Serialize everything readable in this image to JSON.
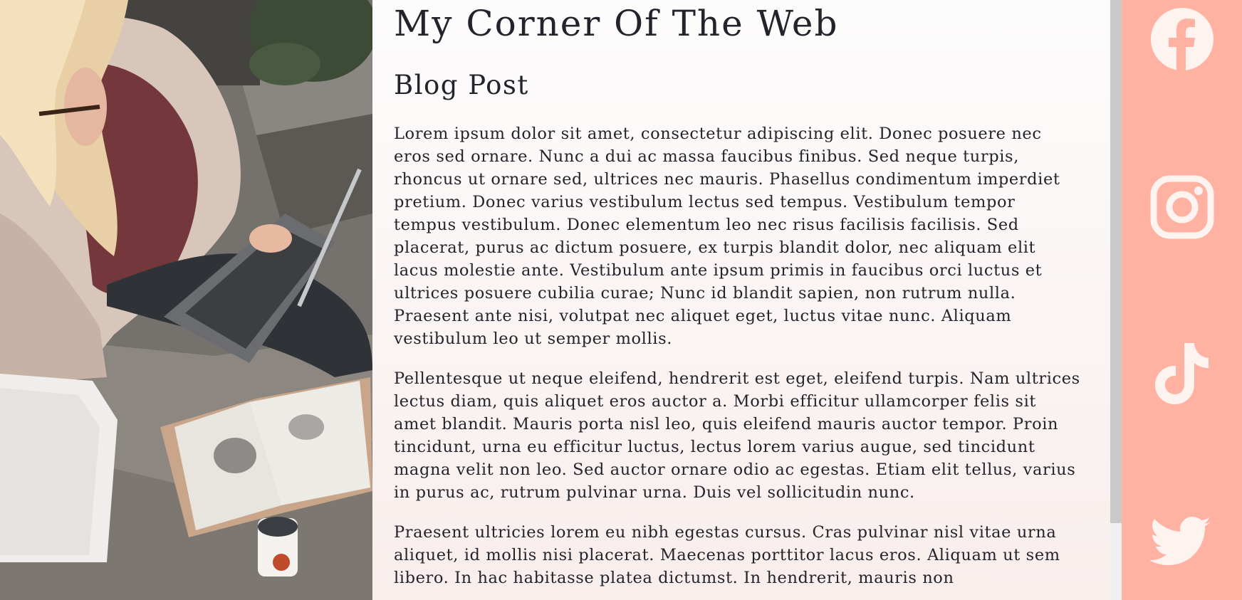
{
  "hero": {
    "alt": "Woman with laptop sitting on stone steps next to an open book and papers"
  },
  "site": {
    "title": "My Corner Of The Web"
  },
  "post": {
    "title": "Blog Post",
    "paragraphs": [
      "Lorem ipsum dolor sit amet, consectetur adipiscing elit. Donec posuere nec eros sed ornare. Nunc a dui ac massa faucibus finibus. Sed neque turpis, rhoncus ut ornare sed, ultrices nec mauris. Phasellus condimentum imperdiet pretium. Donec varius vestibulum lectus sed tempus. Vestibulum tempor tempus vestibulum. Donec elementum leo nec risus facilisis facilisis. Sed placerat, purus ac dictum posuere, ex turpis blandit dolor, nec aliquam elit lacus molestie ante. Vestibulum ante ipsum primis in faucibus orci luctus et ultrices posuere cubilia curae; Nunc id blandit sapien, non rutrum nulla. Praesent ante nisi, volutpat nec aliquet eget, luctus vitae nunc. Aliquam vestibulum leo ut semper mollis.",
      "Pellentesque ut neque eleifend, hendrerit est eget, eleifend turpis. Nam ultrices lectus diam, quis aliquet eros auctor a. Morbi efficitur ullamcorper felis sit amet blandit. Mauris porta nisl leo, quis eleifend mauris auctor tempor. Proin tincidunt, urna eu efficitur luctus, lectus lorem varius augue, sed tincidunt magna velit non leo. Sed auctor ornare odio ac egestas. Etiam elit tellus, varius in purus ac, rutrum pulvinar urna. Duis vel sollicitudin nunc.",
      "Praesent ultricies lorem eu nibh egestas cursus. Cras pulvinar nisl vitae urna aliquet, id mollis nisi placerat. Maecenas porttitor lacus eros. Aliquam ut sem libero. In hac habitasse platea dictumst. In hendrerit, mauris non"
    ]
  },
  "social": {
    "links": [
      {
        "icon": "facebook-icon"
      },
      {
        "icon": "instagram-icon"
      },
      {
        "icon": "tiktok-icon"
      },
      {
        "icon": "twitter-icon"
      }
    ]
  },
  "colors": {
    "sidebar_bg": "#ffb1a2",
    "icon_color": "#fff3f0",
    "text": "#23232b",
    "content_bg_top": "#fdfcfc",
    "content_bg_bottom": "#f8eeec"
  }
}
